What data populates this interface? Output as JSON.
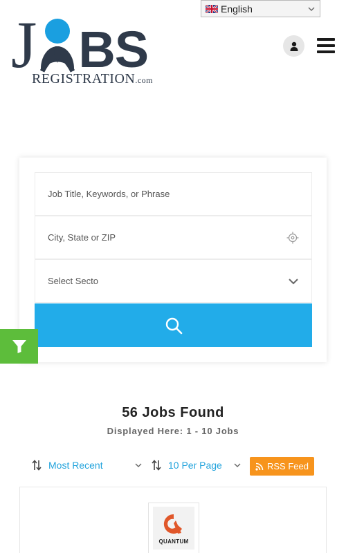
{
  "header": {
    "language": {
      "selected": "English",
      "flag_icon": "uk-flag-icon"
    },
    "logo": {
      "main_j": "J",
      "main_rest": "BS",
      "sub": "REGISTRATION",
      "sub_suffix": ".com"
    },
    "user_icon": "user-icon",
    "menu_icon": "hamburger-icon"
  },
  "search": {
    "keywords_placeholder": "Job Title, Keywords, or Phrase",
    "location_placeholder": "City, State or ZIP",
    "sector_placeholder": "Select Secto",
    "search_icon": "search-icon"
  },
  "filter": {
    "icon": "filter-icon"
  },
  "results": {
    "title": "56 Jobs Found",
    "subtitle": "Displayed Here: 1 - 10 Jobs",
    "sort_by": "Most Recent",
    "per_page": "10 Per Page",
    "rss_label": "RSS Feed"
  },
  "job": {
    "company": "QUANTUM"
  },
  "colors": {
    "accent_blue": "#22ace9",
    "filter_green": "#5dbd3b",
    "rss_orange": "#f7941d",
    "logo_dark": "#2f3a4a"
  }
}
